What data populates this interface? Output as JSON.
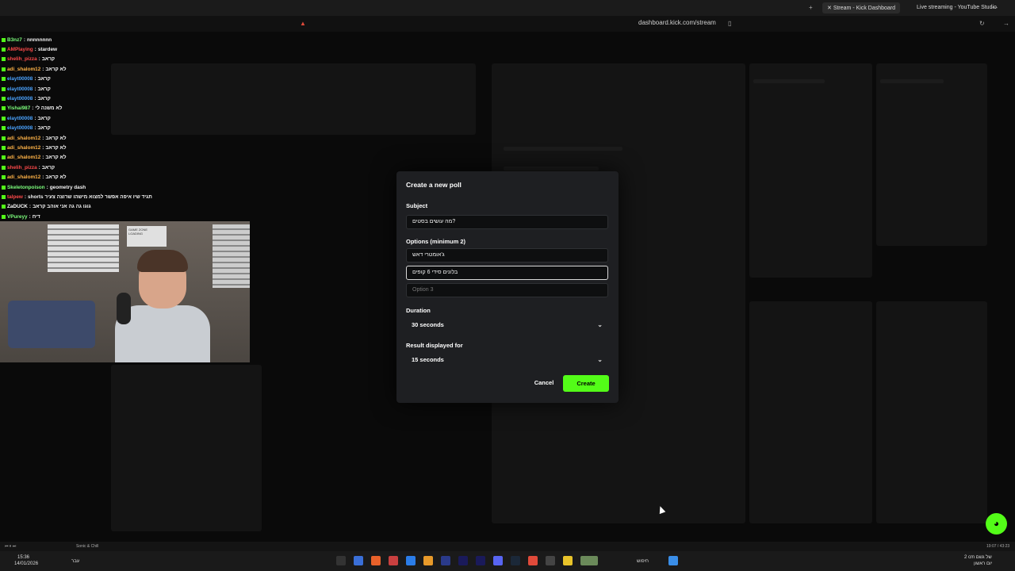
{
  "browser": {
    "url": "dashboard.kick.com/stream",
    "tabs": [
      {
        "label": "Stream - Kick Dashboard",
        "active": true
      },
      {
        "label": "Live streaming - YouTube Studio",
        "active": false
      }
    ]
  },
  "chat": {
    "messages": [
      {
        "user": "B3nz7",
        "text": "nnnnnnnn",
        "color": "#7dff7d"
      },
      {
        "user": "AMPlaying",
        "text": "stardew",
        "color": "#ff4a4a"
      },
      {
        "user": "shelih_pizza",
        "text": "קראב",
        "color": "#ff4a4a"
      },
      {
        "user": "adi_shalom12",
        "text": "לא קראב",
        "color": "#ffb347"
      },
      {
        "user": "elayt00008",
        "text": "קראב",
        "color": "#4aa3ff"
      },
      {
        "user": "elayt00008",
        "text": "קראב",
        "color": "#4aa3ff"
      },
      {
        "user": "elayt00008",
        "text": "קראב",
        "color": "#4aa3ff"
      },
      {
        "user": "Yishai987",
        "text": "לא משנה לי",
        "color": "#7dff7d"
      },
      {
        "user": "elayt00008",
        "text": "קראב",
        "color": "#4aa3ff"
      },
      {
        "user": "elayt00008",
        "text": "קראב",
        "color": "#4aa3ff"
      },
      {
        "user": "adi_shalom12",
        "text": "לא קראב",
        "color": "#ffb347"
      },
      {
        "user": "adi_shalom12",
        "text": "לא קראב",
        "color": "#ffb347"
      },
      {
        "user": "adi_shalom12",
        "text": "לא קראב",
        "color": "#ffb347"
      },
      {
        "user": "shelih_pizza",
        "text": "קראב",
        "color": "#ff4a4a"
      },
      {
        "user": "adi_shalom12",
        "text": "לא קראב",
        "color": "#ffb347"
      },
      {
        "user": "Skeletonpoison",
        "text": "geometry dash",
        "color": "#7dff7d"
      },
      {
        "user": "talpew",
        "text": "shorts תגיד שיו איפה אפשר למצוא מישהו שרוצה צעיר",
        "color": "#ff4a4a"
      },
      {
        "user": "ZaDUCK",
        "text": "גוגו גה גה אני אוהב קראב",
        "color": "#ffffff"
      },
      {
        "user": "VPureyy",
        "text": "דיח",
        "color": "#7dff7d"
      }
    ]
  },
  "cam": {
    "sign": "GAME ZONE",
    "sign_sub": "LOADING"
  },
  "poll": {
    "title": "Create a new poll",
    "subject_label": "Subject",
    "subject_value": "מה עושים בסטים?",
    "options_label": "Options (minimum 2)",
    "option1": "ג'אומטרי דאש",
    "option2": "בלונים סידי 6 קופים",
    "option3_placeholder": "Option 3",
    "duration_label": "Duration",
    "duration_value": "30 seconds",
    "result_label": "Result displayed for",
    "result_value": "15 seconds",
    "cancel": "Cancel",
    "create": "Create"
  },
  "media": {
    "track": "Sonic & Chill",
    "time_right": "19:07 / 43:23"
  },
  "taskbar": {
    "time": "15:36",
    "date": "14/01/2026",
    "lang": "עבר",
    "search": "חיפוש",
    "weather": "2 cm של גשם",
    "weather_sub": "יום ראשון"
  },
  "colors": {
    "accent": "#53fc18"
  }
}
